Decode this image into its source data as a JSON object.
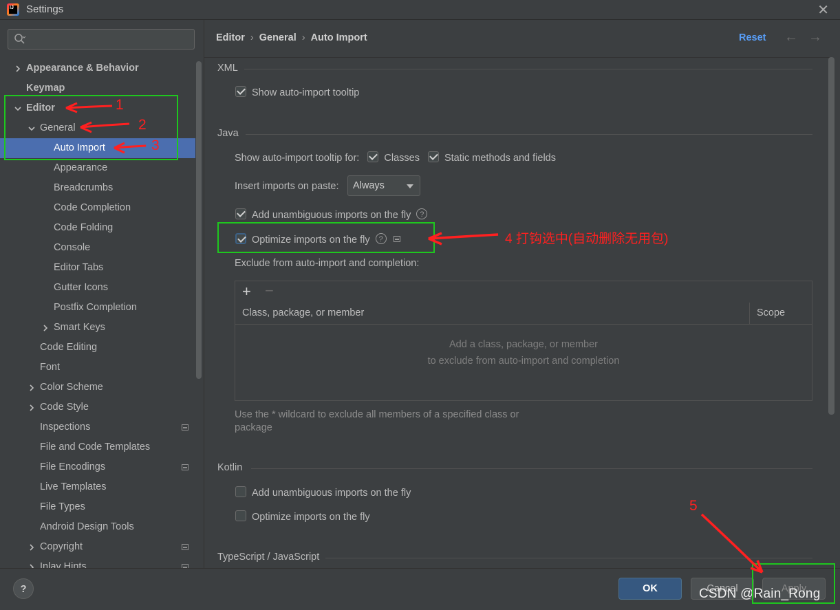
{
  "window": {
    "title": "Settings",
    "app_icon_text": "IJ"
  },
  "search": {
    "placeholder": ""
  },
  "tree": [
    {
      "label": "Appearance & Behavior",
      "level": 0,
      "bold": true,
      "expander": "collapsed"
    },
    {
      "label": "Keymap",
      "level": 0,
      "bold": true,
      "expander": "none"
    },
    {
      "label": "Editor",
      "level": 0,
      "bold": true,
      "expander": "expanded"
    },
    {
      "label": "General",
      "level": 1,
      "bold": false,
      "expander": "expanded"
    },
    {
      "label": "Auto Import",
      "level": 2,
      "bold": false,
      "expander": "none",
      "selected": true
    },
    {
      "label": "Appearance",
      "level": 2,
      "expander": "none"
    },
    {
      "label": "Breadcrumbs",
      "level": 2,
      "expander": "none"
    },
    {
      "label": "Code Completion",
      "level": 2,
      "expander": "none"
    },
    {
      "label": "Code Folding",
      "level": 2,
      "expander": "none"
    },
    {
      "label": "Console",
      "level": 2,
      "expander": "none"
    },
    {
      "label": "Editor Tabs",
      "level": 2,
      "expander": "none"
    },
    {
      "label": "Gutter Icons",
      "level": 2,
      "expander": "none"
    },
    {
      "label": "Postfix Completion",
      "level": 2,
      "expander": "none"
    },
    {
      "label": "Smart Keys",
      "level": 2,
      "expander": "collapsed"
    },
    {
      "label": "Code Editing",
      "level": 1,
      "expander": "none"
    },
    {
      "label": "Font",
      "level": 1,
      "expander": "none"
    },
    {
      "label": "Color Scheme",
      "level": 1,
      "expander": "collapsed"
    },
    {
      "label": "Code Style",
      "level": 1,
      "expander": "collapsed"
    },
    {
      "label": "Inspections",
      "level": 1,
      "expander": "none",
      "icon": true
    },
    {
      "label": "File and Code Templates",
      "level": 1,
      "expander": "none"
    },
    {
      "label": "File Encodings",
      "level": 1,
      "expander": "none",
      "icon": true
    },
    {
      "label": "Live Templates",
      "level": 1,
      "expander": "none"
    },
    {
      "label": "File Types",
      "level": 1,
      "expander": "none"
    },
    {
      "label": "Android Design Tools",
      "level": 1,
      "expander": "none"
    },
    {
      "label": "Copyright",
      "level": 1,
      "expander": "collapsed",
      "icon": true
    },
    {
      "label": "Inlay Hints",
      "level": 1,
      "expander": "collapsed",
      "icon": true
    }
  ],
  "breadcrumb": {
    "items": [
      "Editor",
      "General",
      "Auto Import"
    ],
    "separator": "›"
  },
  "header": {
    "reset_label": "Reset",
    "back_icon": "←",
    "forward_icon": "→"
  },
  "sections": {
    "xml": {
      "title": "XML",
      "show_tooltip": {
        "label": "Show auto-import tooltip",
        "checked": true
      }
    },
    "java": {
      "title": "Java",
      "tooltip_for_label": "Show auto-import tooltip for:",
      "classes": {
        "label": "Classes",
        "checked": true
      },
      "static_methods": {
        "label": "Static methods and fields",
        "checked": true
      },
      "insert_on_paste_label": "Insert imports on paste:",
      "insert_on_paste_value": "Always",
      "add_unambiguous": {
        "label": "Add unambiguous imports on the fly",
        "checked": true
      },
      "optimize": {
        "label": "Optimize imports on the fly",
        "checked": true
      },
      "exclude_label": "Exclude from auto-import and completion:",
      "table": {
        "add_icon": "+",
        "remove_icon": "−",
        "columns": [
          "Class, package, or member",
          "Scope"
        ],
        "empty_line1": "Add a class, package, or member",
        "empty_line2": "to exclude from auto-import and completion"
      },
      "hint": "Use the * wildcard to exclude all members of a specified class or package"
    },
    "kotlin": {
      "title": "Kotlin",
      "add_unambiguous": {
        "label": "Add unambiguous imports on the fly",
        "checked": false
      },
      "optimize": {
        "label": "Optimize imports on the fly",
        "checked": false
      }
    },
    "typescript": {
      "title": "TypeScript / JavaScript"
    }
  },
  "footer": {
    "help_label": "?",
    "ok_label": "OK",
    "cancel_label": "Cancel",
    "apply_label": "Apply"
  },
  "annotations": {
    "n1": "1",
    "n2": "2",
    "n3": "3",
    "n5": "5",
    "note4": "4 打钩选中(自动删除无用包)",
    "color": "#ff2020",
    "box_color": "#1ec71e"
  },
  "watermark": "CSDN @Rain_Rong",
  "colors": {
    "selection": "#4b6eaf",
    "accent_link": "#589df6",
    "ok_button": "#365880",
    "background": "#3c3f41"
  }
}
